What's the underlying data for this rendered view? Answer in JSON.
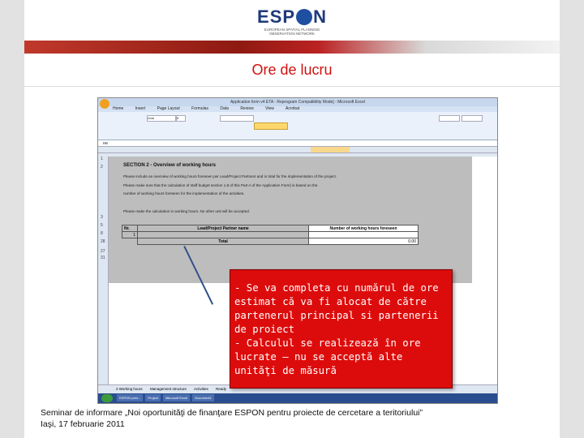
{
  "header": {
    "logo_left": "ESP",
    "logo_right": "N",
    "logo_tagline_1": "EUROPEAN SPATIAL PLANNING",
    "logo_tagline_2": "OBSERVATION NETWORK"
  },
  "slide": {
    "title": "Ore de lucru"
  },
  "excel": {
    "window_title": "Application form v4 ETA - Reprogram Compatibility Mode] - Microsoft Excel",
    "menu": [
      "Home",
      "Insert",
      "Page Layout",
      "Formulas",
      "Data",
      "Review",
      "View",
      "Acrobat"
    ],
    "font_name": "Arial",
    "font_size": "8",
    "name_box": "H8",
    "row_numbers": [
      "1",
      "2",
      "3",
      "5",
      "8",
      "28",
      "27",
      "31"
    ],
    "section_title": "SECTION 2 - Overview of working hours",
    "lines": [
      "Please include an overview of working hours foreseen per Lead/Project Partners and in total for the implementation of the project.",
      "Please make sure that the calculation of staff budget section 1.8 of this Part A of the Application Form) is based on the",
      "number of working hours foreseen for the implementation of the activities.",
      "Please make the calculation in working hours. No other unit will be accepted."
    ],
    "table": {
      "headers": [
        "Nr.",
        "Lead/Project Partner name",
        "Number of working hours foreseen"
      ],
      "row1": [
        "1",
        "",
        ""
      ],
      "total_label": "Total",
      "total_value": "0.00"
    },
    "sheet_tabs": [
      "2 Working hours",
      "Management structure",
      "Activities"
    ],
    "status": "Ready",
    "taskbar": [
      "ESPON pres...",
      "Project",
      "Microsoft Excel",
      "Document1"
    ]
  },
  "callout": {
    "text": "- Se va completa cu numărul de ore estimat că va fi alocat de către partenerul principal si partenerii de proiect\n- Calculul se realizează în ore lucrate – nu se acceptă alte unităţi de măsură"
  },
  "footer": {
    "line1": "Seminar de informare „Noi oportunităţi de finanţare ESPON pentru proiecte de cercetare a teritoriului”",
    "line2": "Iaşi, 17 februarie 2011"
  }
}
